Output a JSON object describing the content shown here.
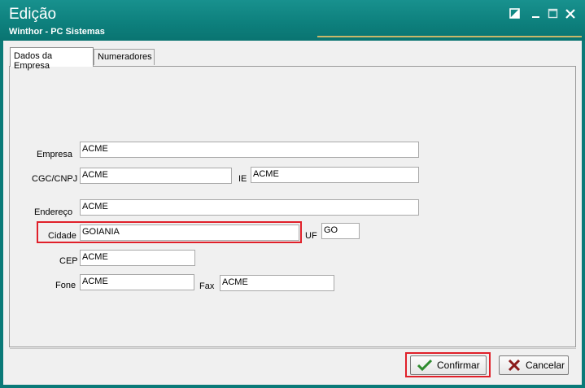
{
  "window": {
    "title": "Edição",
    "subtitle": "Winthor - PC Sistemas"
  },
  "tabs": [
    {
      "label": "Dados da Empresa",
      "active": true
    },
    {
      "label": "Numeradores",
      "active": false
    }
  ],
  "form": {
    "empresa": {
      "label": "Empresa",
      "value": "ACME"
    },
    "cgc": {
      "label": "CGC/CNPJ",
      "value": "ACME"
    },
    "ie": {
      "label": "IE",
      "value": "ACME"
    },
    "endereco": {
      "label": "Endereço",
      "value": "ACME"
    },
    "cidade": {
      "label": "Cidade",
      "value": "GOIANIA"
    },
    "uf": {
      "label": "UF",
      "value": "GO"
    },
    "cep": {
      "label": "CEP",
      "value": "ACME"
    },
    "fone": {
      "label": "Fone",
      "value": "ACME"
    },
    "fax": {
      "label": "Fax",
      "value": "ACME"
    }
  },
  "buttons": {
    "confirm_label": "Confirmar",
    "cancel_label": "Cancelar"
  },
  "colors": {
    "titlebar": "#0d7f7c",
    "highlight": "#e0202a",
    "confirm_icon": "#2e8b2e",
    "cancel_icon": "#8b1a1a"
  }
}
